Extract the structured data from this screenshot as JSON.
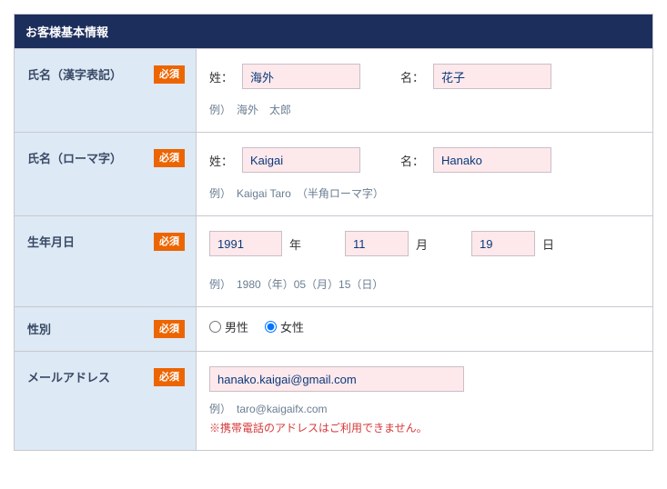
{
  "header": {
    "title": "お客様基本情報"
  },
  "badge": {
    "required": "必須"
  },
  "rows": {
    "name_kanji": {
      "label": "氏名（漢字表記）",
      "sei_label": "姓：",
      "mei_label": "名：",
      "sei_value": "海外",
      "mei_value": "花子",
      "example": "例）　海外　太郎"
    },
    "name_roman": {
      "label": "氏名（ローマ字）",
      "sei_label": "姓：",
      "mei_label": "名：",
      "sei_value": "Kaigai",
      "mei_value": "Hanako",
      "example": "例）　Kaigai Taro　（半角ローマ字）"
    },
    "birthdate": {
      "label": "生年月日",
      "year_value": "1991",
      "year_suffix": "年",
      "month_value": "11",
      "month_suffix": "月",
      "day_value": "19",
      "day_suffix": "日",
      "example": "例）　1980（年）05（月）15（日）"
    },
    "gender": {
      "label": "性別",
      "male_label": "男性",
      "female_label": "女性",
      "selected": "female"
    },
    "email": {
      "label": "メールアドレス",
      "value": "hanako.kaigai@gmail.com",
      "example": "例）　taro@kaigaifx.com",
      "note": "※携帯電話のアドレスはご利用できません。"
    }
  }
}
